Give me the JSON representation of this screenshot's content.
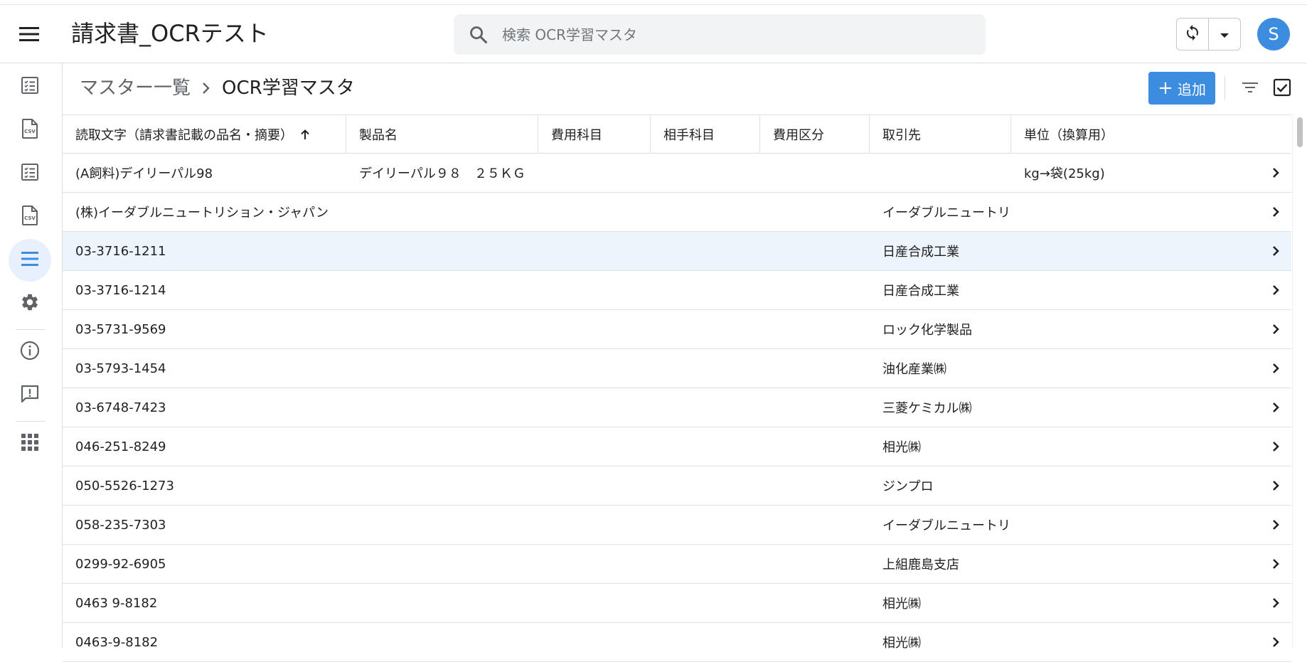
{
  "app": {
    "title": "請求書_OCRテスト",
    "user_initial": "S",
    "accent_color": "#3c8ce0"
  },
  "search": {
    "placeholder": "検索 OCR学習マスタ",
    "value": ""
  },
  "sidebar": {
    "items": [
      {
        "icon": "checklist-icon"
      },
      {
        "icon": "csv-file-icon"
      },
      {
        "icon": "checklist-icon"
      },
      {
        "icon": "csv-file-icon"
      },
      {
        "icon": "list-icon",
        "active": true
      },
      {
        "icon": "gear-icon"
      },
      {
        "icon": "info-icon"
      },
      {
        "icon": "feedback-icon"
      },
      {
        "icon": "apps-grid-icon"
      }
    ]
  },
  "breadcrumb": {
    "parent": "マスター一覧",
    "current": "OCR学習マスタ"
  },
  "toolbar": {
    "add_label": "追加"
  },
  "table": {
    "columns": [
      "読取文字（請求書記載の品名・摘要）",
      "製品名",
      "費用科目",
      "相手科目",
      "費用区分",
      "取引先",
      "単位（換算用）"
    ],
    "rows": [
      [
        "(A飼料)デイリーパル98",
        "デイリーパル９８　２５ＫＧ",
        "",
        "",
        "",
        "",
        "kg→袋(25kg)"
      ],
      [
        "(株)イーダブルニュートリション・ジャパン",
        "",
        "",
        "",
        "",
        "イーダブルニュートリ",
        ""
      ],
      [
        "03-3716-1211",
        "",
        "",
        "",
        "",
        "日産合成工業",
        ""
      ],
      [
        "03-3716-1214",
        "",
        "",
        "",
        "",
        "日産合成工業",
        ""
      ],
      [
        "03-5731-9569",
        "",
        "",
        "",
        "",
        "ロック化学製品",
        ""
      ],
      [
        "03-5793-1454",
        "",
        "",
        "",
        "",
        "油化産業㈱",
        ""
      ],
      [
        "03-6748-7423",
        "",
        "",
        "",
        "",
        "三菱ケミカル㈱",
        ""
      ],
      [
        "046-251-8249",
        "",
        "",
        "",
        "",
        "相光㈱",
        ""
      ],
      [
        "050-5526-1273",
        "",
        "",
        "",
        "",
        "ジンプロ",
        ""
      ],
      [
        "058-235-7303",
        "",
        "",
        "",
        "",
        "イーダブルニュートリ",
        ""
      ],
      [
        "0299-92-6905",
        "",
        "",
        "",
        "",
        "上組鹿島支店",
        ""
      ],
      [
        "0463 9-8182",
        "",
        "",
        "",
        "",
        "相光㈱",
        ""
      ],
      [
        "0463-9-8182",
        "",
        "",
        "",
        "",
        "相光㈱",
        ""
      ]
    ]
  }
}
